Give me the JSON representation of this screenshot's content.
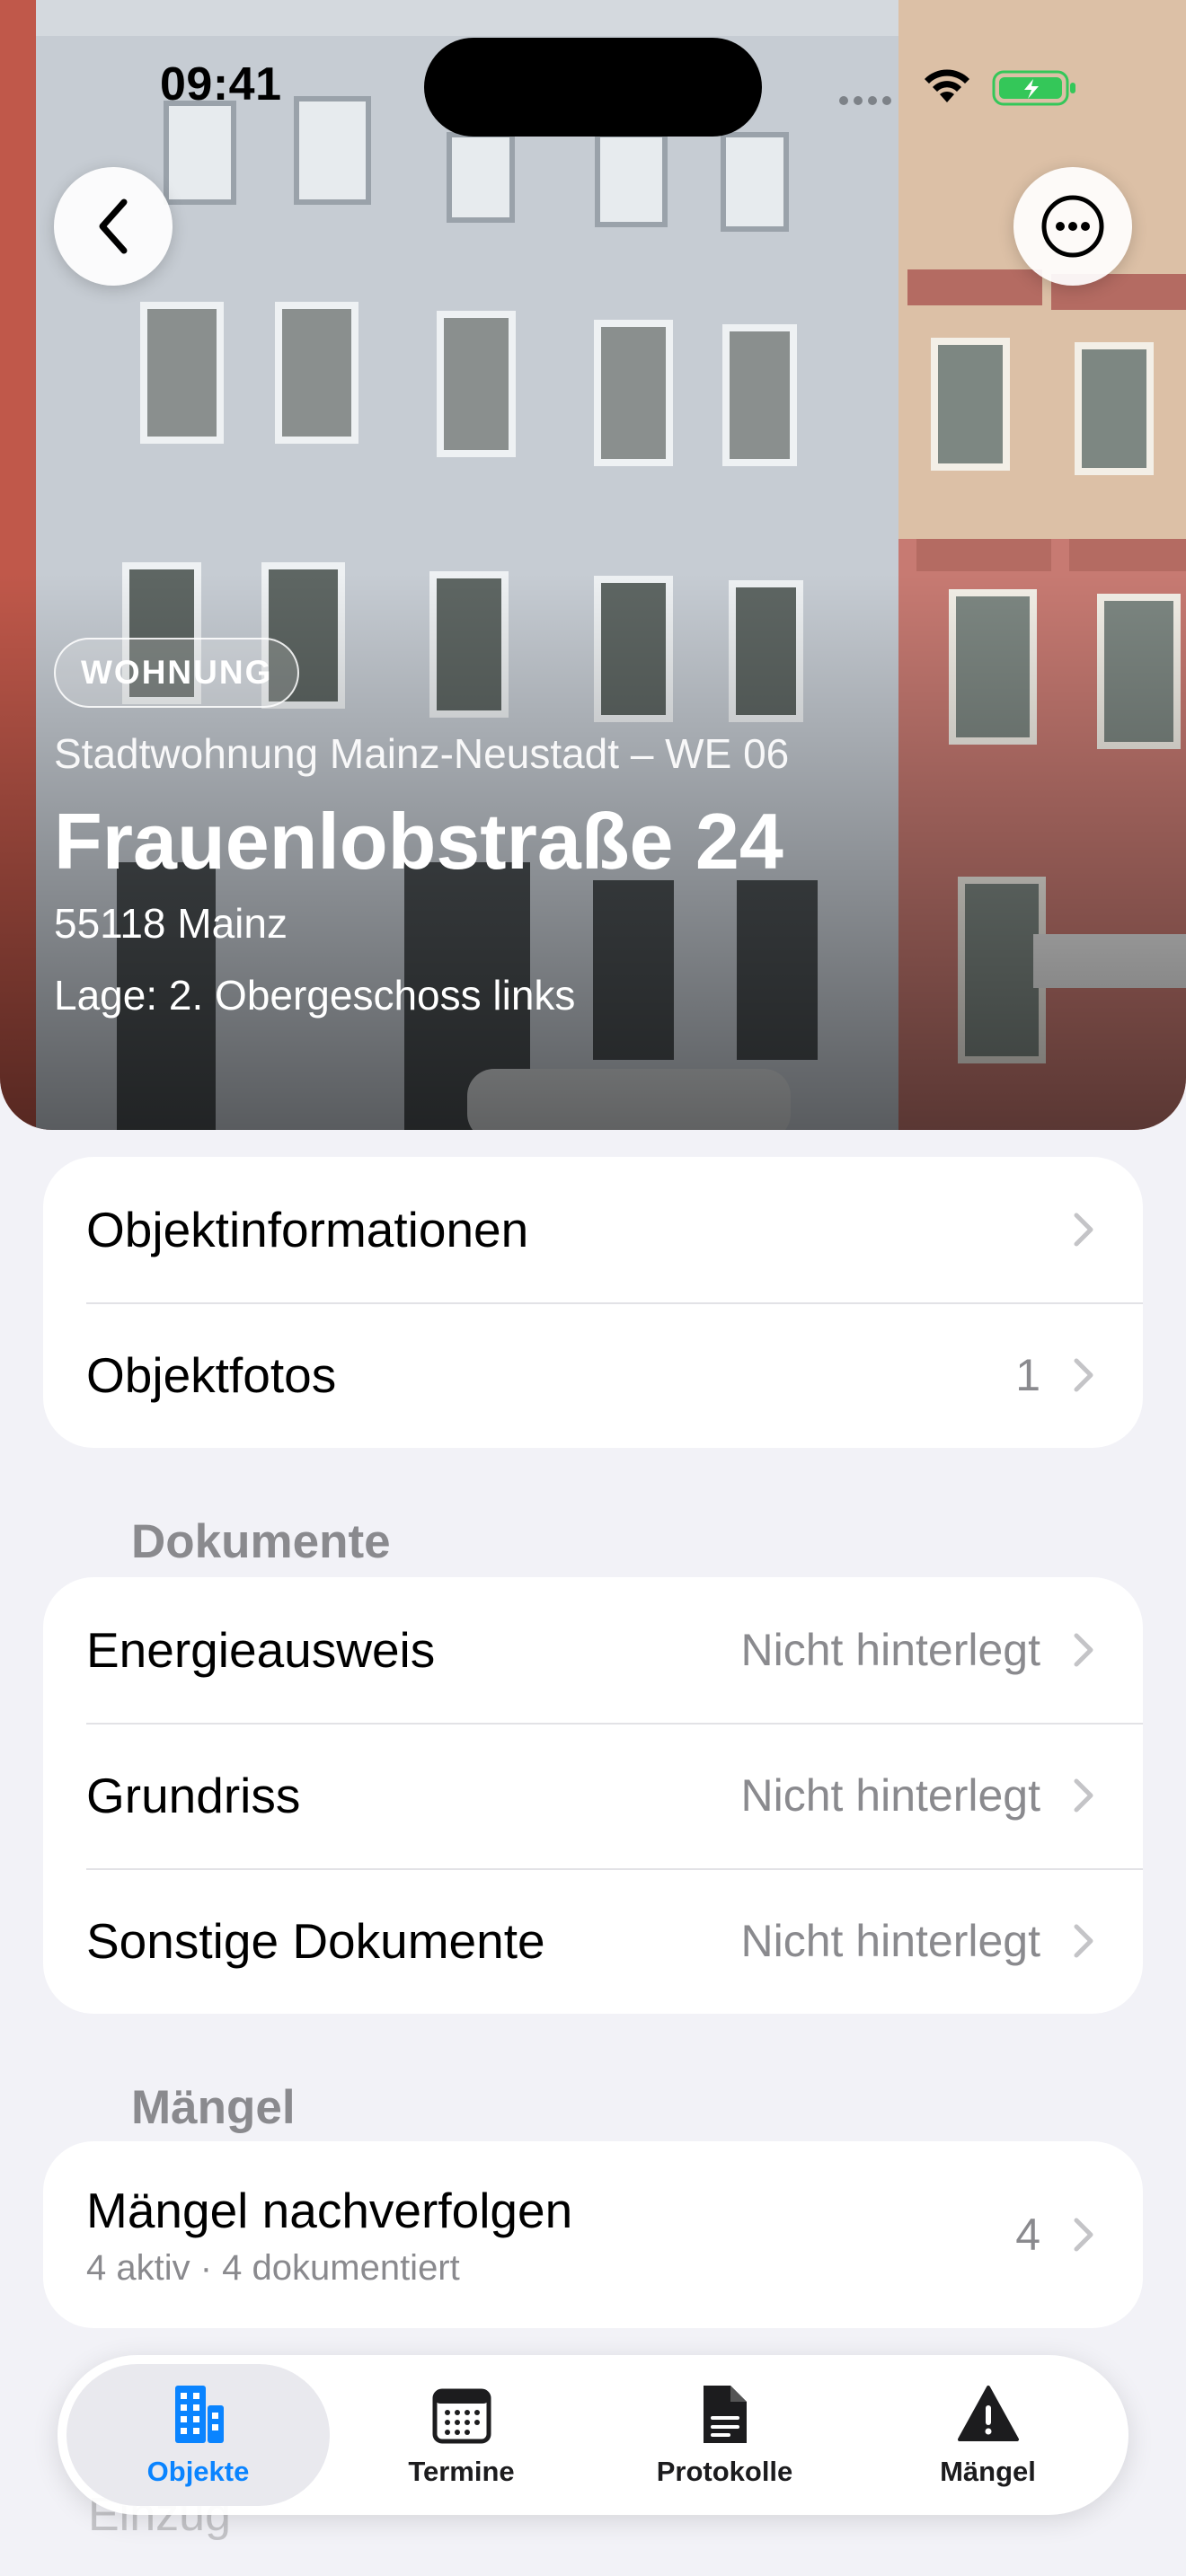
{
  "status_bar": {
    "time": "09:41"
  },
  "hero": {
    "badge": "WOHNUNG",
    "subtitle": "Stadtwohnung Mainz-Neustadt – WE 06",
    "title": "Frauenlobstraße 24",
    "city": "55118 Mainz",
    "floor": "Lage: 2. Obergeschoss links"
  },
  "group_main": {
    "items": [
      {
        "label": "Objektinformationen",
        "value": ""
      },
      {
        "label": "Objektfotos",
        "value": "1"
      }
    ]
  },
  "documents": {
    "header": "Dokumente",
    "items": [
      {
        "label": "Energieausweis",
        "value": "Nicht hinterlegt"
      },
      {
        "label": "Grundriss",
        "value": "Nicht hinterlegt"
      },
      {
        "label": "Sonstige Dokumente",
        "value": "Nicht hinterlegt"
      }
    ]
  },
  "defects": {
    "header": "Mängel",
    "item": {
      "label": "Mängel nachverfolgen",
      "sub": "4 aktiv · 4 dokumentiert",
      "value": "4"
    }
  },
  "behind_tabbar": {
    "label": "Einzug"
  },
  "tabbar": {
    "tabs": [
      {
        "label": "Objekte",
        "icon": "building-icon",
        "active": true
      },
      {
        "label": "Termine",
        "icon": "calendar-icon",
        "active": false
      },
      {
        "label": "Protokolle",
        "icon": "document-icon",
        "active": false
      },
      {
        "label": "Mängel",
        "icon": "warning-icon",
        "active": false
      }
    ]
  },
  "colors": {
    "accent": "#0a84ff",
    "background": "#f2f2f7",
    "battery": "#34c759"
  }
}
